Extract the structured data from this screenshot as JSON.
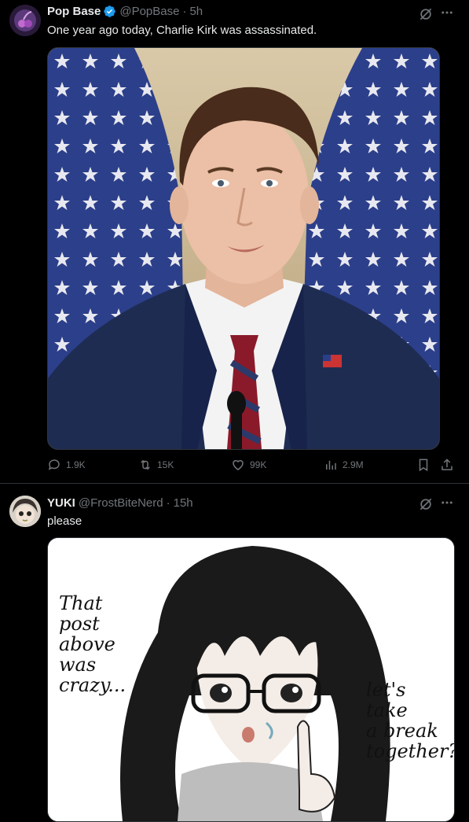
{
  "post1": {
    "display_name": "Pop Base",
    "handle": "@PopBase",
    "separator": "·",
    "time": "5h",
    "text": "One year ago today, Charlie Kirk was assassinated.",
    "stats": {
      "replies": "1.9K",
      "reposts": "15K",
      "likes": "99K",
      "views": "2.9M"
    }
  },
  "post2": {
    "display_name": "YUKI",
    "handle": "@FrostBiteNerd",
    "separator": "·",
    "time": "15h",
    "text": "please",
    "image_text": {
      "left_lines": [
        "That",
        "post",
        "above",
        "was",
        "crazy..."
      ],
      "right_lines": [
        "let's",
        "take",
        "a break",
        "together?"
      ]
    }
  },
  "colors": {
    "background": "#000000",
    "text": "#e7e9ea",
    "secondary": "#71767b",
    "verified": "#1d9bf0",
    "divider": "#2f3336"
  },
  "icons": [
    "verified-badge-icon",
    "grok-icon",
    "more-icon",
    "reply-icon",
    "repost-icon",
    "like-icon",
    "views-icon",
    "bookmark-icon",
    "share-icon"
  ]
}
